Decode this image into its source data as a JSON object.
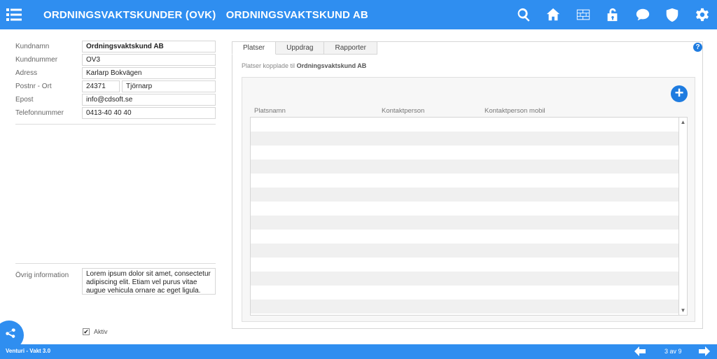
{
  "header": {
    "title_main": "ORDNINGSVAKTSKUNDER (OVK)",
    "title_sub": "ORDNINGSVAKTSKUND AB",
    "icons": [
      "search-icon",
      "home-icon",
      "wall-icon",
      "lock-icon",
      "chat-icon",
      "shield-icon",
      "gear-icon"
    ]
  },
  "form": {
    "kundnamn": {
      "label": "Kundnamn",
      "value": "Ordningsvaktskund AB"
    },
    "kundnummer": {
      "label": "Kundnummer",
      "value": "OV3"
    },
    "adress": {
      "label": "Adress",
      "value": "Karlarp Bokvägen"
    },
    "postnr_ort": {
      "label": "Postnr - Ort",
      "postnr": "24371",
      "ort": "Tjörnarp"
    },
    "epost": {
      "label": "Epost",
      "value": "info@cdsoft.se"
    },
    "telefon": {
      "label": "Telefonnummer",
      "value": "0413-40 40 40"
    },
    "ovrig": {
      "label": "Övrig information",
      "value": "Lorem ipsum dolor sit amet, consectetur adipiscing elit. Etiam vel purus vitae augue vehicula ornare ac eget ligula. Nunc vitae"
    },
    "aktiv": {
      "label": "Aktiv",
      "checked": true,
      "mark": "✔"
    }
  },
  "tabs": [
    {
      "label": "Platser",
      "active": true
    },
    {
      "label": "Uppdrag",
      "active": false
    },
    {
      "label": "Rapporter",
      "active": false
    }
  ],
  "panel": {
    "subtitle_prefix": "Platser kopplade til",
    "subtitle_name": "Ordningsvaktskund AB",
    "help": "?",
    "add": "+",
    "columns": [
      "Platsnamn",
      "Kontaktperson",
      "Kontaktperson mobil"
    ]
  },
  "footer": {
    "app_name": "Venturi - Vakt 3.0",
    "pager": "3 av 9"
  },
  "colors": {
    "primary": "#2f8ef0",
    "accent": "#1f7ce0"
  }
}
